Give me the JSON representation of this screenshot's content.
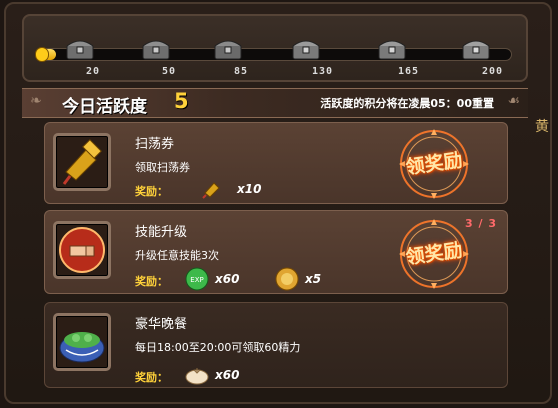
{
  "progress": {
    "fraction": 0.04,
    "colors": {
      "fill": "#ffc21a",
      "track": "#0d0b0a"
    },
    "milestones": [
      {
        "value": "20",
        "icon": "chest-icon"
      },
      {
        "value": "50",
        "icon": "chest-icon"
      },
      {
        "value": "85",
        "icon": "chest-icon"
      },
      {
        "value": "130",
        "icon": "chest-icon"
      },
      {
        "value": "165",
        "icon": "chest-icon"
      },
      {
        "value": "200",
        "icon": "chest-icon"
      }
    ]
  },
  "header": {
    "title": "今日活跃度",
    "points": "5",
    "reset_note": "活跃度的积分将在凌晨05：00重置"
  },
  "side_text": "黄",
  "tasks": [
    {
      "name": "扫荡券",
      "desc": "领取扫荡券",
      "reward_label": "奖励：",
      "rewards": [
        {
          "icon": "sweep-ticket-icon",
          "count": "x10"
        }
      ],
      "claim_label": "领奖励",
      "progress": ""
    },
    {
      "name": "技能升级",
      "desc": "升级任意技能3次",
      "reward_label": "奖励：",
      "rewards": [
        {
          "icon": "exp-icon",
          "count": "x60"
        },
        {
          "icon": "gold-coin-icon",
          "count": "x5"
        }
      ],
      "claim_label": "领奖励",
      "progress": "3 / 3"
    },
    {
      "name": "豪华晚餐",
      "desc": "每日18:00至20:00可领取60精力",
      "reward_label": "奖励：",
      "rewards": [
        {
          "icon": "bun-icon",
          "count": "x60"
        }
      ],
      "claim_label": "",
      "progress": ""
    }
  ]
}
